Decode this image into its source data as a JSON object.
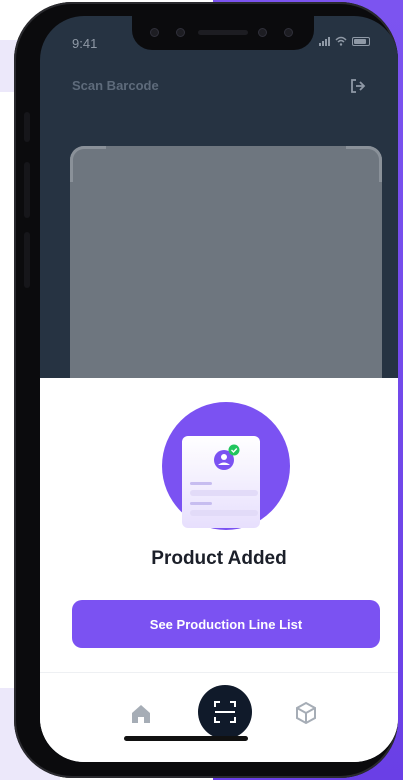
{
  "status_bar": {
    "time": "9:41"
  },
  "header": {
    "title": "Scan Barcode"
  },
  "sheet": {
    "title": "Product Added",
    "button_label": "See Production Line List"
  },
  "tabs": [
    {
      "name": "home",
      "icon": "home-icon"
    },
    {
      "name": "scan",
      "icon": "scan-icon",
      "active": true
    },
    {
      "name": "products",
      "icon": "box-icon"
    }
  ],
  "colors": {
    "accent": "#7b52f2",
    "dark": "#101a2a",
    "screen_bg": "#263342",
    "success": "#22c55e"
  }
}
